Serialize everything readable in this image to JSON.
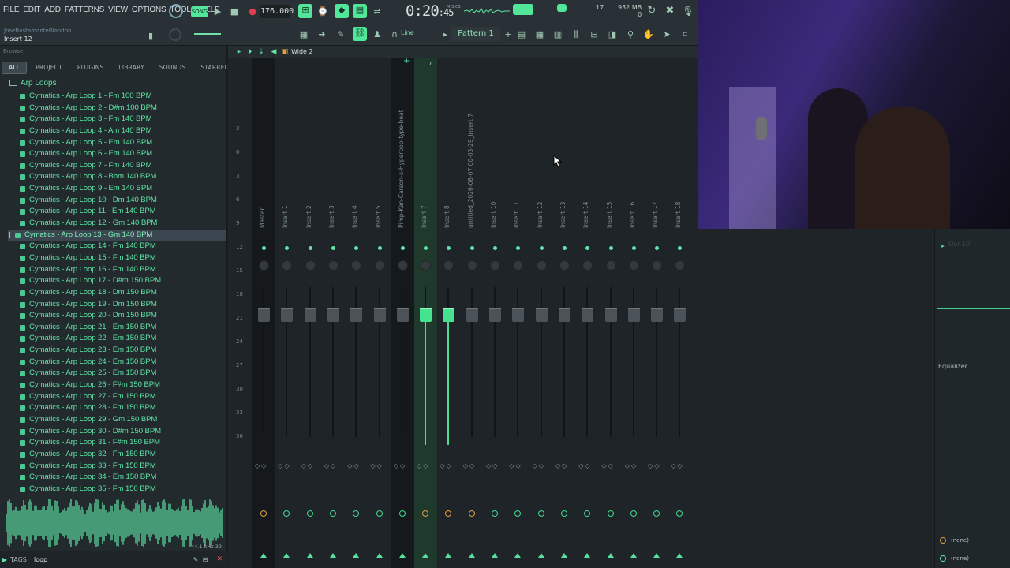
{
  "menu": [
    "FILE",
    "EDIT",
    "ADD",
    "PATTERNS",
    "VIEW",
    "OPTIONS",
    "TOOLS",
    "HELP"
  ],
  "transport": {
    "tempo": "176.000",
    "time": "0:20",
    "time_sub": ":45",
    "time_unit": "M:S:CS"
  },
  "status": {
    "cpu": "17",
    "memory": "932 MB",
    "poly": "0"
  },
  "hint": {
    "user": "JoseBustamanteBlandon",
    "text": "Insert 12"
  },
  "toolbar": {
    "pattern": "Pattern 1",
    "snap": "Line"
  },
  "browser": {
    "title": "Browser",
    "tabs": [
      "ALL",
      "PROJECT",
      "PLUGINS",
      "LIBRARY",
      "SOUNDS",
      "STARRED"
    ],
    "folder": "Arp Loops",
    "files": [
      "Cymatics - Arp Loop 1 - Fm 100 BPM",
      "Cymatics - Arp Loop 2 - D#m 100 BPM",
      "Cymatics - Arp Loop 3 - Fm 140 BPM",
      "Cymatics - Arp Loop 4 - Am 140 BPM",
      "Cymatics - Arp Loop 5 - Em 140 BPM",
      "Cymatics - Arp Loop 6 - Em 140 BPM",
      "Cymatics - Arp Loop 7 - Fm 140 BPM",
      "Cymatics - Arp Loop 8 - Bbm 140 BPM",
      "Cymatics - Arp Loop 9 - Em 140 BPM",
      "Cymatics - Arp Loop 10 - Dm 140 BPM",
      "Cymatics - Arp Loop 11 - Em 140 BPM",
      "Cymatics - Arp Loop 12 - Gm 140 BPM",
      "Cymatics - Arp Loop 13 - Gm 140 BPM",
      "Cymatics - Arp Loop 14 - Fm 140 BPM",
      "Cymatics - Arp Loop 15 - Fm 140 BPM",
      "Cymatics - Arp Loop 16 - Fm 140 BPM",
      "Cymatics - Arp Loop 17 - D#m 150 BPM",
      "Cymatics - Arp Loop 18 - Dm 150 BPM",
      "Cymatics - Arp Loop 19 - Dm 150 BPM",
      "Cymatics - Arp Loop 20 - Dm 150 BPM",
      "Cymatics - Arp Loop 21 - Em 150 BPM",
      "Cymatics - Arp Loop 22 - Em 150 BPM",
      "Cymatics - Arp Loop 23 - Em 150 BPM",
      "Cymatics - Arp Loop 24 - Em 150 BPM",
      "Cymatics - Arp Loop 25 - Em 150 BPM",
      "Cymatics - Arp Loop 26 - F#m 150 BPM",
      "Cymatics - Arp Loop 27 - Fm 150 BPM",
      "Cymatics - Arp Loop 28 - Fm 150 BPM",
      "Cymatics - Arp Loop 29 - Gm 150 BPM",
      "Cymatics - Arp Loop 30 - D#m 150 BPM",
      "Cymatics - Arp Loop 31 - F#m 150 BPM",
      "Cymatics - Arp Loop 32 - Fm 150 BPM",
      "Cymatics - Arp Loop 33 - Fm 150 BPM",
      "Cymatics - Arp Loop 34 - Em 150 BPM",
      "Cymatics - Arp Loop 35 - Fm 150 BPM"
    ],
    "selected_index": 12,
    "sample_info": "44.1 kHz 32",
    "tags_label": "TAGS",
    "tags_value": "loop"
  },
  "mixer": {
    "title": "Wide 2",
    "strips": [
      "Master",
      "Insert 1",
      "Insert 2",
      "Insert 3",
      "Insert 4",
      "Insert 5",
      "Pimp-Ken-Carson-x-Hyperpop-type-beat",
      "Insert 7",
      "Insert 8",
      "untitled_2026-08-07 00-03-29_Insert 7",
      "Insert 10",
      "Insert 11",
      "Insert 12",
      "Insert 13",
      "Insert 14",
      "Insert 15",
      "Insert 16",
      "Insert 17",
      "Insert 18"
    ],
    "scale": [
      "3",
      "0",
      "3",
      "6",
      "9",
      "12",
      "15",
      "18",
      "21",
      "24",
      "27",
      "30",
      "33",
      "36"
    ],
    "playhead_label": "7"
  },
  "fxpanel": {
    "slot": "Slot 10",
    "eq": "Equalizer",
    "none1": "(none)",
    "none2": "(none)"
  },
  "colors": {
    "accent": "#5ee5a6",
    "orange": "#e39a40"
  }
}
